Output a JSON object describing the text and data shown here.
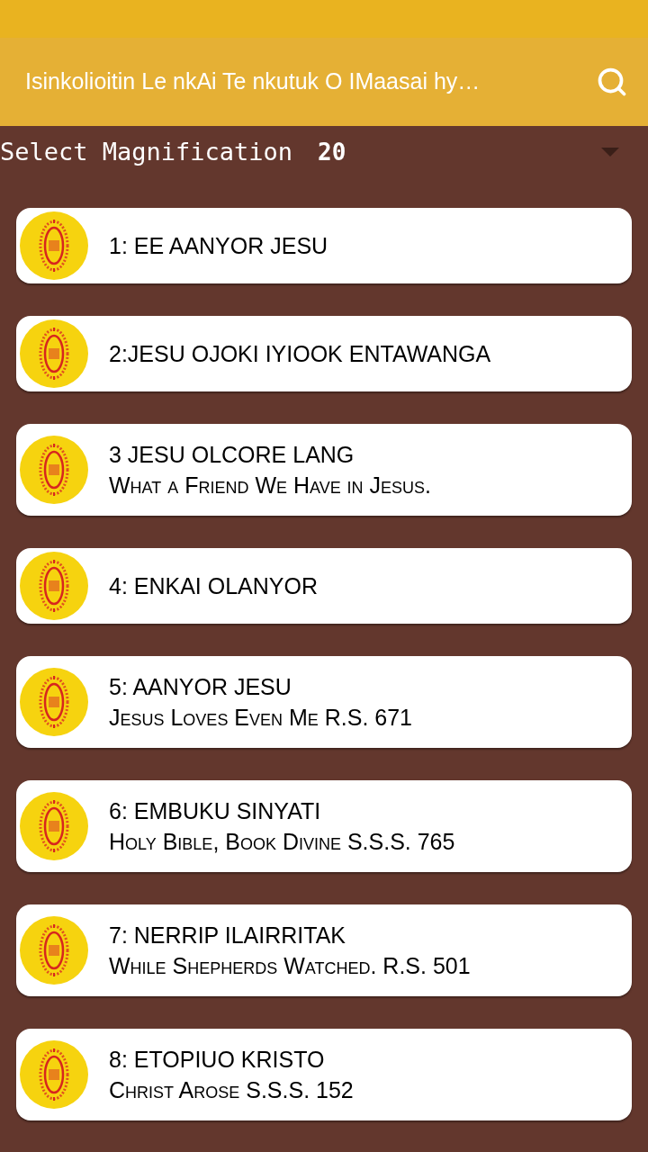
{
  "app_bar": {
    "title": "Isinkolioitin Le nkAi Te nkutuk O IMaasai hy…"
  },
  "magnification": {
    "label": "Select Magnification",
    "value": "20"
  },
  "hymns": [
    {
      "title": "1: EE AANYOR JESU"
    },
    {
      "title": "2:JESU OJOKI IYIOOK ENTAWANGA"
    },
    {
      "title": "3 JESU OLCORE LANG",
      "subtitle": "What a Friend We Have in Jesus."
    },
    {
      "title": "4: ENKAI OLANYOR"
    },
    {
      "title": "5: AANYOR JESU",
      "subtitle": "Jesus Loves Even Me R.S. 671"
    },
    {
      "title": "6: EMBUKU SINYATI",
      "subtitle": "Holy Bible, Book Divine S.S.S. 765"
    },
    {
      "title": "7: NERRIP ILAIRRITAK",
      "subtitle": "While Shepherds Watched. R.S. 501"
    },
    {
      "title": "8: ETOPIUO KRISTO",
      "subtitle": "Christ Arose S.S.S. 152"
    }
  ]
}
